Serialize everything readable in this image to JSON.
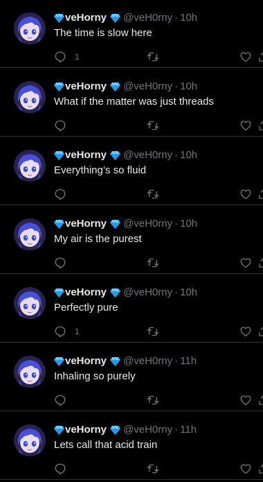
{
  "theme": {
    "background": "#000000",
    "text_primary": "#e7e9ea",
    "text_secondary": "#71767b",
    "divider": "#2f3336",
    "gem_color": "#1d9bf0"
  },
  "icons": {
    "verified_badge": "gem-icon",
    "reply": "reply-icon",
    "retweet": "retweet-icon",
    "like": "heart-icon",
    "share": "share-icon"
  },
  "tweets": [
    {
      "name": "veHorny",
      "handle": "@veH0rny",
      "separator": "·",
      "time": "10h",
      "text": "The time is slow here",
      "reply_count": "1"
    },
    {
      "name": "veHorny",
      "handle": "@veH0rny",
      "separator": "·",
      "time": "10h",
      "text": "What if the matter was just threads",
      "reply_count": ""
    },
    {
      "name": "veHorny",
      "handle": "@veH0rny",
      "separator": "·",
      "time": "10h",
      "text": "Everything’s so fluid",
      "reply_count": ""
    },
    {
      "name": "veHorny",
      "handle": "@veH0rny",
      "separator": "·",
      "time": "10h",
      "text": "My air is the purest",
      "reply_count": ""
    },
    {
      "name": "veHorny",
      "handle": "@veH0rny",
      "separator": "·",
      "time": "10h",
      "text": "Perfectly pure",
      "reply_count": "1"
    },
    {
      "name": "veHorny",
      "handle": "@veH0rny",
      "separator": "·",
      "time": "11h",
      "text": "Inhaling so purely",
      "reply_count": ""
    },
    {
      "name": "veHorny",
      "handle": "@veH0rny",
      "separator": "·",
      "time": "11h",
      "text": "Lets call that acid train",
      "reply_count": ""
    }
  ]
}
